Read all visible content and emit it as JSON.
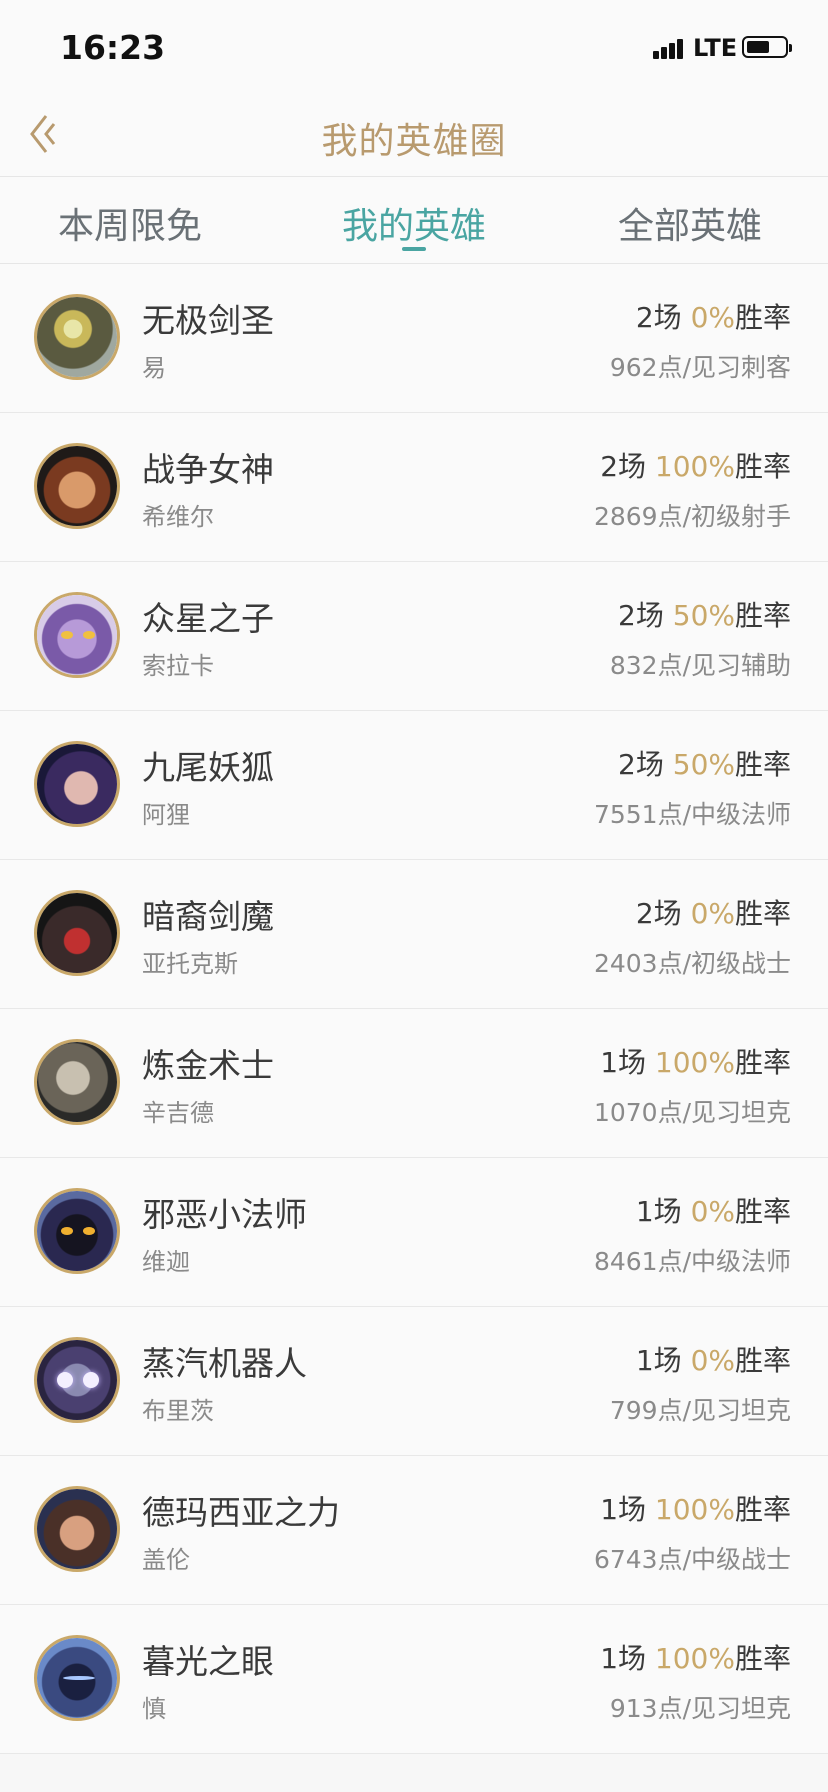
{
  "status": {
    "time": "16:23",
    "network": "LTE"
  },
  "nav": {
    "title": "我的英雄圈"
  },
  "tabs": [
    {
      "label": "本周限免"
    },
    {
      "label": "我的英雄"
    },
    {
      "label": "全部英雄"
    }
  ],
  "heroes": [
    {
      "name": "无极剑圣",
      "title": "易",
      "games": "2场",
      "rate": "0%",
      "rate_label": "胜率",
      "points": "962点/见习刺客",
      "avatar": "hero-avatar-yi"
    },
    {
      "name": "战争女神",
      "title": "希维尔",
      "games": "2场",
      "rate": "100%",
      "rate_label": "胜率",
      "points": "2869点/初级射手",
      "avatar": "hero-avatar-sivir"
    },
    {
      "name": "众星之子",
      "title": "索拉卡",
      "games": "2场",
      "rate": "50%",
      "rate_label": "胜率",
      "points": "832点/见习辅助",
      "avatar": "hero-avatar-soraka"
    },
    {
      "name": "九尾妖狐",
      "title": "阿狸",
      "games": "2场",
      "rate": "50%",
      "rate_label": "胜率",
      "points": "7551点/中级法师",
      "avatar": "hero-avatar-ahri"
    },
    {
      "name": "暗裔剑魔",
      "title": "亚托克斯",
      "games": "2场",
      "rate": "0%",
      "rate_label": "胜率",
      "points": "2403点/初级战士",
      "avatar": "hero-avatar-aatrox"
    },
    {
      "name": "炼金术士",
      "title": "辛吉德",
      "games": "1场",
      "rate": "100%",
      "rate_label": "胜率",
      "points": "1070点/见习坦克",
      "avatar": "hero-avatar-singed"
    },
    {
      "name": "邪恶小法师",
      "title": "维迦",
      "games": "1场",
      "rate": "0%",
      "rate_label": "胜率",
      "points": "8461点/中级法师",
      "avatar": "hero-avatar-veigar"
    },
    {
      "name": "蒸汽机器人",
      "title": "布里茨",
      "games": "1场",
      "rate": "0%",
      "rate_label": "胜率",
      "points": "799点/见习坦克",
      "avatar": "hero-avatar-blitzcrank"
    },
    {
      "name": "德玛西亚之力",
      "title": "盖伦",
      "games": "1场",
      "rate": "100%",
      "rate_label": "胜率",
      "points": "6743点/中级战士",
      "avatar": "hero-avatar-garen"
    },
    {
      "name": "暮光之眼",
      "title": "慎",
      "games": "1场",
      "rate": "100%",
      "rate_label": "胜率",
      "points": "913点/见习坦克",
      "avatar": "hero-avatar-shen"
    }
  ],
  "colors": {
    "accent_teal": "#4aa5a2",
    "accent_gold": "#c9a869",
    "title_gold": "#b89a6e"
  }
}
